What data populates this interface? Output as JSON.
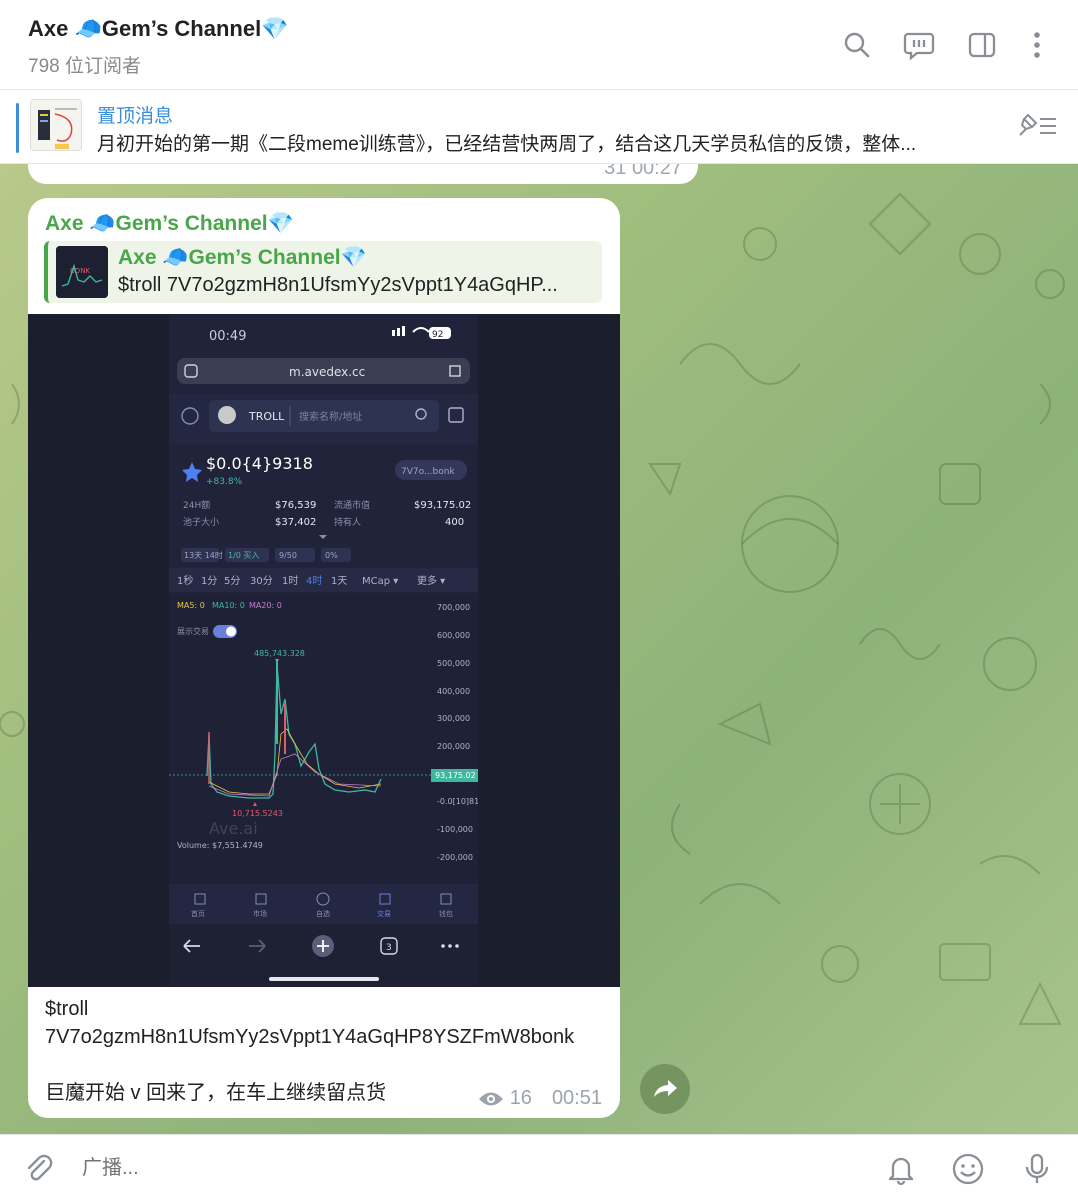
{
  "header": {
    "channel_name": "Axe 🧢Gem’s Channel💎",
    "subscribers": "798 位订阅者"
  },
  "pinned": {
    "label": "置顶消息",
    "text": "月初开始的第一期《二段meme训练营》，已经结营快两周了，结合这几天学员私信的反馈，整体..."
  },
  "previous_message": {
    "views": "31",
    "time": "00:27"
  },
  "message": {
    "author": "Axe 🧢Gem’s Channel💎",
    "forward": {
      "author": "Axe 🧢Gem’s Channel💎",
      "text": "$troll 7V7o2gzmH8n1UfsmYy2sVppt1Y4aGqHP..."
    },
    "caption_line1": "$troll",
    "caption_line2": "7V7o2gzmH8n1UfsmYy2sVppt1Y4aGqHP8YSZFmW8bonk",
    "caption_line3": "巨魔开始 v 回来了，在车上继续留点货",
    "views": "16",
    "time": "00:51"
  },
  "screenshot": {
    "status_time": "00:49",
    "battery": "92",
    "url": "m.avedex.cc",
    "token": "TROLL",
    "search_placeholder": "搜索名称/地址",
    "price": "$0.0{4}9318",
    "change": "+83.8%",
    "address_chip": "7V7o...bonk",
    "stats": {
      "vol_label": "24H额",
      "vol_value": "$76,539",
      "mcap_label": "流通市值",
      "mcap_value": "$93,175.02",
      "pool_label": "池子大小",
      "pool_value": "$37,402",
      "holders_label": "持有人",
      "holders_value": "400"
    },
    "chips": [
      "13天 14时",
      "1/0 买入",
      "9/50",
      "0%"
    ],
    "timeframes": [
      "1秒",
      "1分",
      "5分",
      "30分",
      "1时",
      "4时",
      "1天",
      "MCap ▾",
      "更多 ▾"
    ],
    "ma": [
      "MA5: 0",
      "MA10: 0",
      "MA20: 0"
    ],
    "toggle_label": "展示交易",
    "y_ticks": [
      "700,000",
      "600,000",
      "500,000",
      "400,000",
      "300,000",
      "200,000",
      "93,175.02",
      "-0.0[10]81",
      "-100,000",
      "-200,000"
    ],
    "peak_label": "485,743.328",
    "low_label": "10,715.5243",
    "watermark": "Ave.ai",
    "volume": "Volume: $7,551.4749",
    "nav": [
      "首页",
      "市场",
      "自选",
      "交易",
      "钱包"
    ],
    "tab_count": "3"
  },
  "input": {
    "placeholder": "广播..."
  },
  "colors": {
    "accent_blue": "#3a8fd8",
    "author_green": "#4aa64a",
    "chart_up": "#3fb8a0",
    "chart_down": "#e05a6a"
  }
}
